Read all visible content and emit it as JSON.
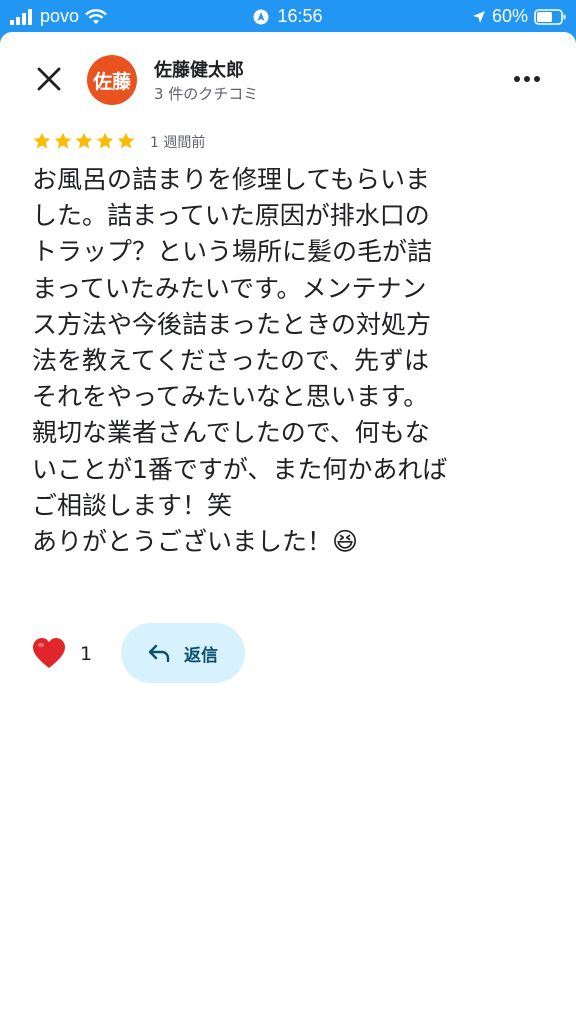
{
  "status_bar": {
    "carrier": "povo",
    "time": "16:56",
    "battery_percent": "60%",
    "icons": [
      "signal-icon",
      "wifi-icon",
      "location-icon",
      "battery-icon"
    ]
  },
  "header": {
    "avatar_text": "佐藤",
    "author_name": "佐藤健太郎",
    "review_count": "3 件のクチコミ",
    "close_icon": "close-icon",
    "more_icon": "more-options-icon"
  },
  "review": {
    "rating": 5,
    "time_ago": "1 週間前",
    "lines": [
      "お風呂の詰まりを修理してもらいま",
      "した。詰まっていた原因が排水口の",
      "トラップ？という場所に髪の毛が詰",
      "まっていたみたいです。メンテナン",
      "ス方法や今後詰まったときの対処方",
      "法を教えてくださったので、先ずは",
      "それをやってみたいなと思います。",
      "親切な業者さんでしたので、何もな",
      "いことが1番ですが、また何かあれば",
      "ご相談します！笑",
      "ありがとうございました！😆"
    ]
  },
  "actions": {
    "like_count": "1",
    "reply_label": "返信"
  },
  "colors": {
    "status_bar": "#2196f3",
    "avatar": "#e8531f",
    "star": "#fbbc04",
    "reply_bg": "#d7f2fc",
    "heart": "#e0262b"
  }
}
